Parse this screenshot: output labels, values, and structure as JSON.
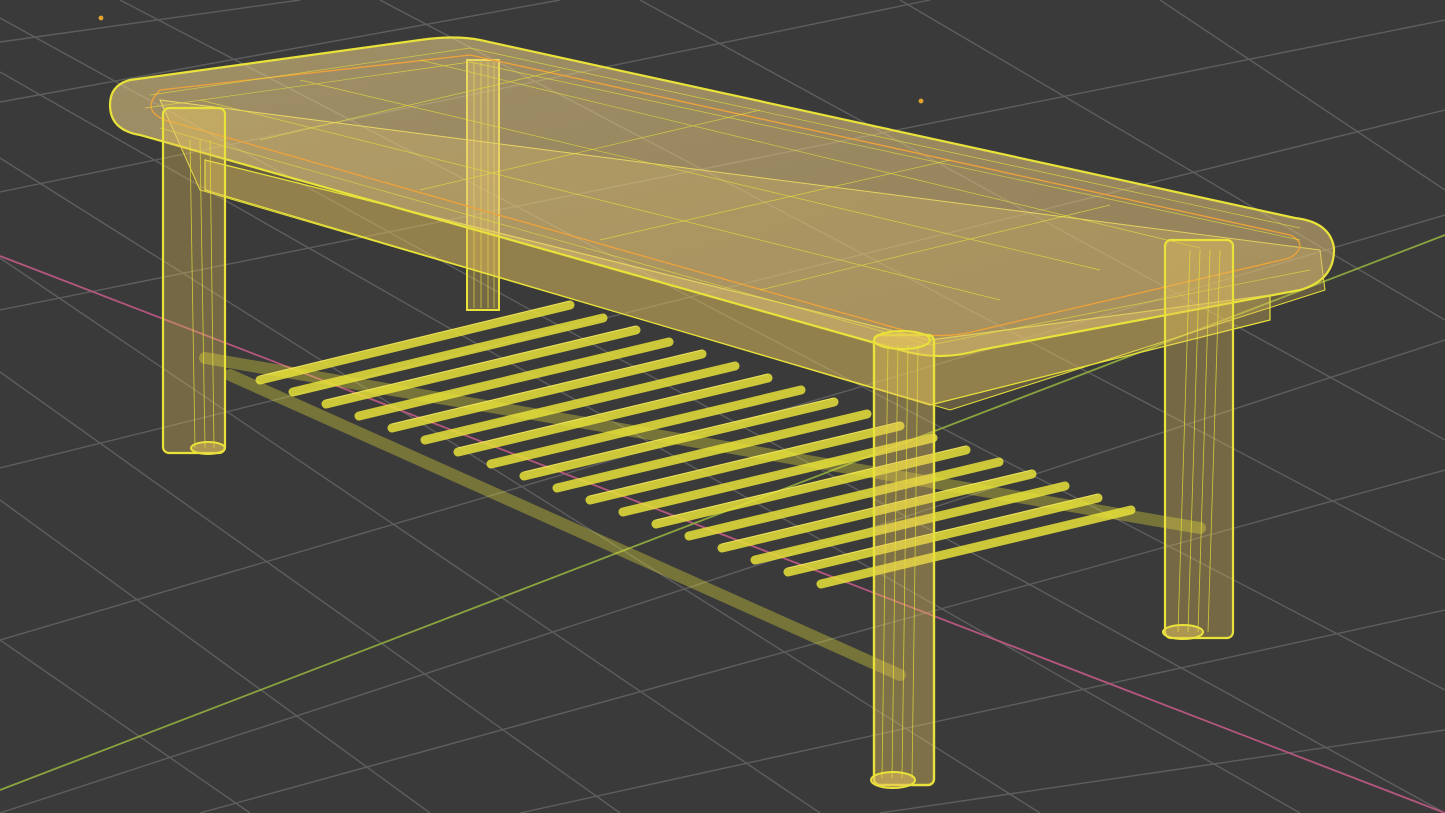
{
  "viewport": {
    "mode": "wireframe-xray",
    "selected_object": "coffee-table"
  },
  "colors": {
    "background": "#3a3a3a",
    "grid_line": "#5c5c5c",
    "axis_x": "#b4577e",
    "axis_y": "#7e9a3a",
    "wire": "#e8e23a",
    "wire_dim": "#c9c12c",
    "fill": "#e6c35c",
    "edge_orange": "#f0a23a"
  },
  "icons": {
    "object_origin": "dot-icon"
  }
}
